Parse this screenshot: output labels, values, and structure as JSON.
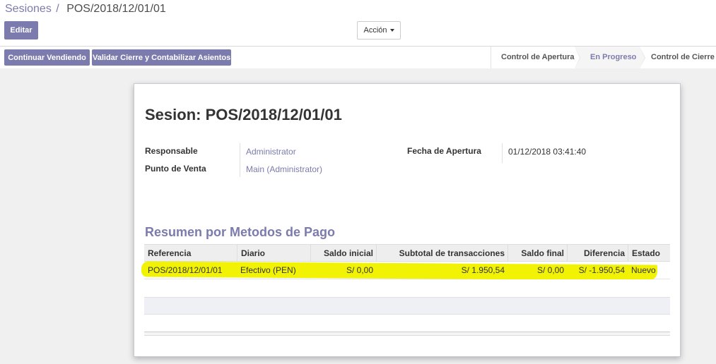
{
  "breadcrumb": {
    "parent": "Sesiones",
    "separator": "/",
    "current": "POS/2018/12/01/01"
  },
  "toolbar": {
    "edit_label": "Editar",
    "action_label": "Acción"
  },
  "statusbar": {
    "buttons": {
      "continue": "Continuar Vendiendo",
      "validate": "Validar Cierre y Contabilizar Asientos"
    },
    "steps": [
      "Control de Apertura",
      "En Progreso",
      "Control de Cierre"
    ],
    "current_step": "En Progreso"
  },
  "form": {
    "title": "Sesion: POS/2018/12/01/01",
    "fields": {
      "responsable": {
        "label": "Responsable",
        "value": "Administrator"
      },
      "punto_venta": {
        "label": "Punto de Venta",
        "value": "Main (Administrator)"
      },
      "fecha_apertura": {
        "label": "Fecha de Apertura",
        "value": "01/12/2018 03:41:40"
      }
    },
    "payments": {
      "title": "Resumen por Metodos de Pago",
      "columns": [
        "Referencia",
        "Diario",
        "Saldo inicial",
        "Subtotal de transacciones",
        "Saldo final",
        "Diferencia",
        "Estado"
      ],
      "rows": [
        [
          "POS/2018/12/01/01",
          "Efectivo (PEN)",
          "S/ 0,00",
          "S/ 1.950,54",
          "S/ 0,00",
          "S/ -1.950,54",
          "Nuevo"
        ]
      ]
    }
  },
  "colors": {
    "brand": "#7c7bad",
    "highlight": "#f2f205"
  }
}
